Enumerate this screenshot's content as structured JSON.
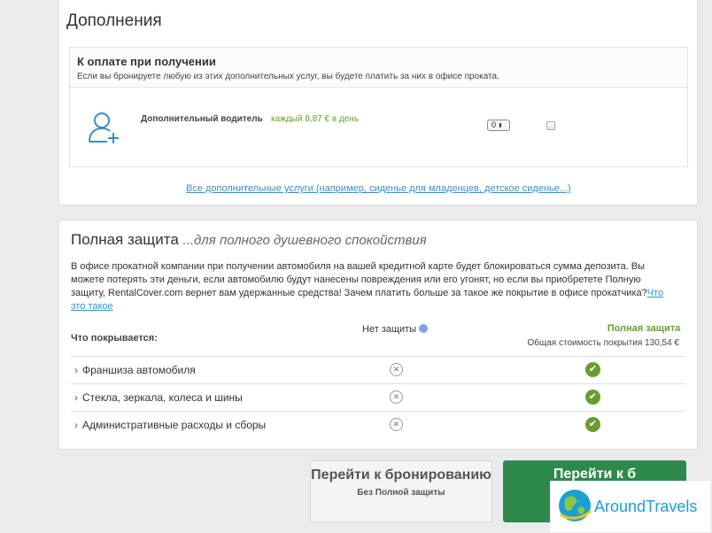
{
  "addons": {
    "title": "Дополнения",
    "pay_on_pickup": {
      "title": "К оплате при получении",
      "description": "Если вы бронируете любую из этих дополнительных услуг, вы будете платить за них в офисе проката."
    },
    "extra_driver": {
      "label": "Дополнительный водитель",
      "price": "каждый 8,87 € в день",
      "quantity": "0",
      "checked": false,
      "icon": "add-user-icon"
    },
    "all_services_link": "Все дополнительные услуги (например, сиденье для младенцев, детское сиденье...)"
  },
  "protection": {
    "title": "Полная защита",
    "subtitle": "...для полного душевного спокойствия",
    "text": "В офисе прокатной компании при получении автомобиля на вашей кредитной карте будет блокироваться сумма депозита. Вы можете потерять эти деньги, если автомобилю будут нанесены повреждения или его угонят, но если вы приобретете Полную защиту, RentalCover.com вернет вам удержанные средства! Зачем платить больше за такое же покрытие в офисе прокатчика?",
    "link_part1": "Что",
    "link_part2": "это такое",
    "covers_label": "Что покрывается:",
    "no_protection": "Нет защиты",
    "full_protection": "Полная защита",
    "full_cost": "Общая стоимость покрытия 130,54 €",
    "rows": [
      {
        "label": "Франшиза автомобиля"
      },
      {
        "label": "Стекла, зеркала, колеса и шины"
      },
      {
        "label": "Административные расходы и сборы"
      }
    ],
    "accent_color": "#6a9c2f"
  },
  "buttons": {
    "without": {
      "label": "Перейти к бронированию",
      "sub": "Без Полной защиты"
    },
    "with": {
      "label": "Перейти к б"
    }
  },
  "watermark": {
    "text": "AroundTravels"
  }
}
